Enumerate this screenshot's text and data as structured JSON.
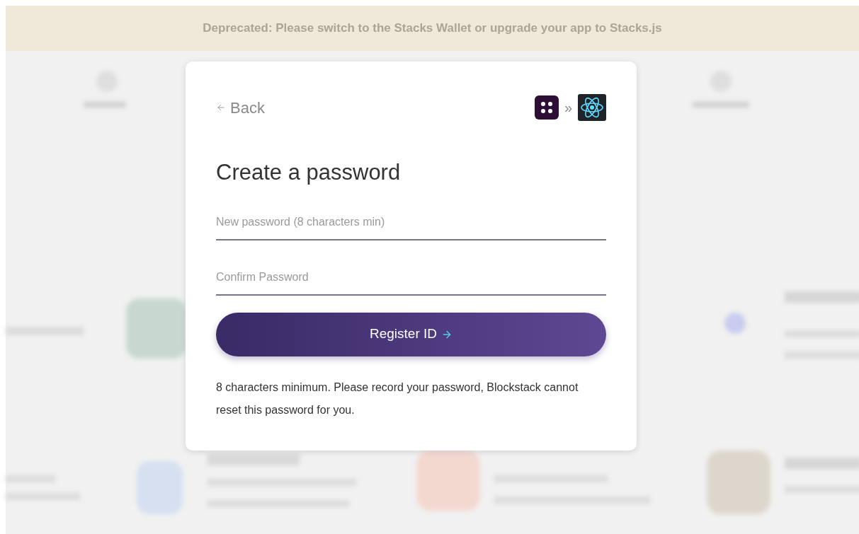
{
  "banner": {
    "text": "Deprecated: Please switch to the Stacks Wallet or upgrade your app to Stacks.js"
  },
  "dialog": {
    "back_label": "Back",
    "separator": "»",
    "title": "Create a password",
    "fields": [
      {
        "placeholder": "New password (8 characters min)"
      },
      {
        "placeholder": "Confirm Password"
      }
    ],
    "button": {
      "label": "Register ID"
    },
    "hint": "8 characters minimum. Please record your password, Blockstack cannot reset this password for you."
  }
}
